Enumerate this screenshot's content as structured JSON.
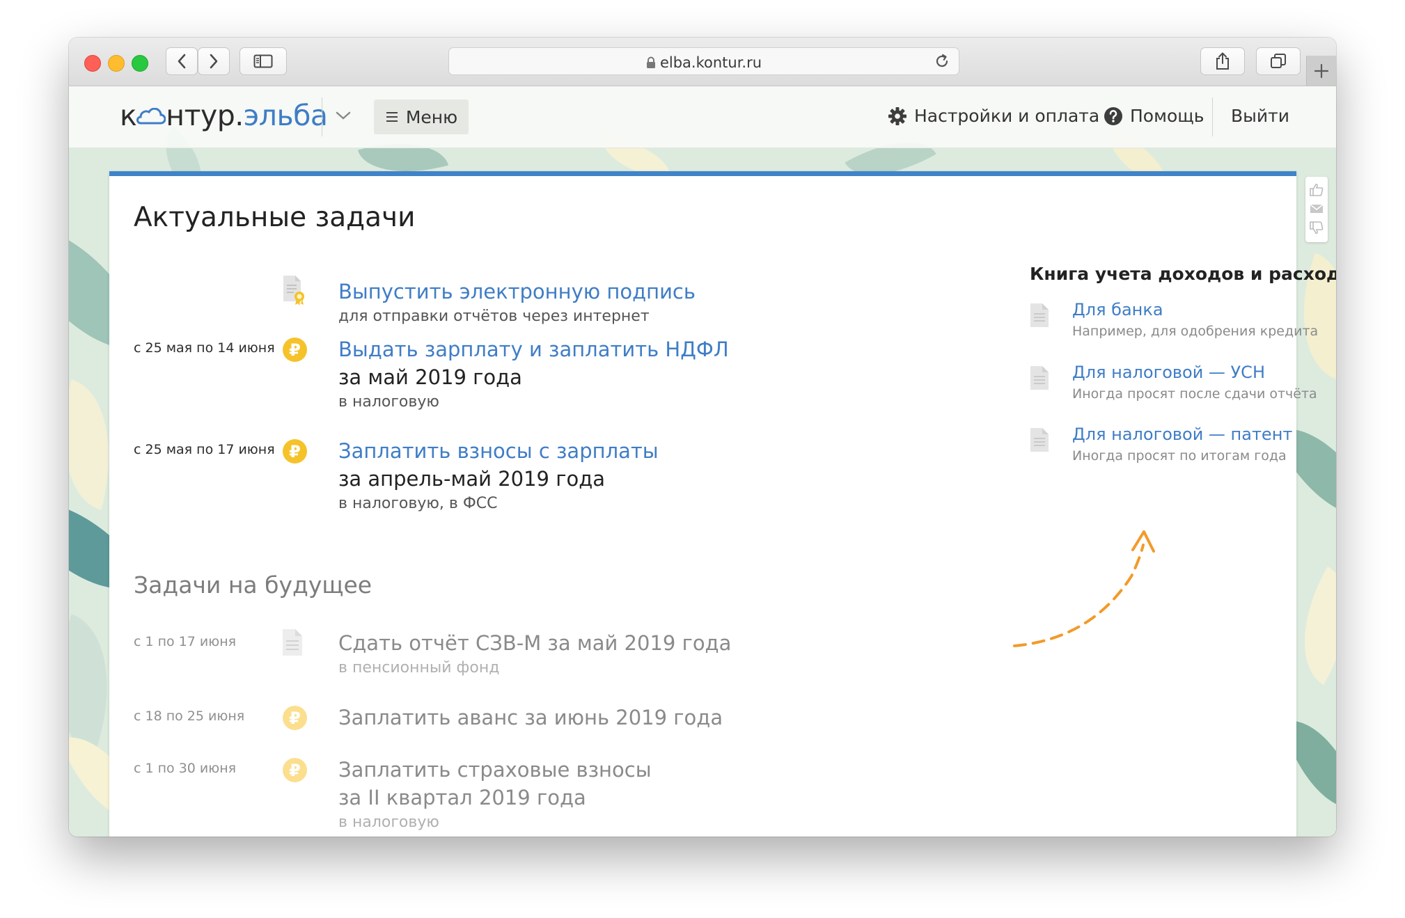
{
  "browser": {
    "url": "elba.kontur.ru",
    "icons": [
      "back-icon",
      "forward-icon",
      "sidebar-icon",
      "lock-icon",
      "reload-icon",
      "share-icon",
      "tabs-icon",
      "plus-icon"
    ]
  },
  "header": {
    "logo_part1": "к",
    "logo_part2": "нтур.",
    "logo_part3": "эльба",
    "menu_label": "Меню",
    "settings_label": "Настройки и оплата",
    "help_label": "Помощь",
    "logout_label": "Выйти",
    "brand_blue": "#3f7dc6"
  },
  "current": {
    "heading": "Актуальные задачи",
    "tasks": [
      {
        "date": "",
        "icon": "certificate-icon",
        "title": "Выпустить электронную подпись",
        "period": "",
        "subtitle": "для отправки отчётов через интернет"
      },
      {
        "date": "с 25 мая по 14 июня",
        "icon": "ruble-coin-icon",
        "title": "Выдать зарплату и заплатить НДФЛ",
        "period": "за май 2019 года",
        "subtitle": "в налоговую"
      },
      {
        "date": "с 25 мая по 17 июня",
        "icon": "ruble-coin-icon",
        "title": "Заплатить взносы с зарплаты",
        "period": "за апрель-май 2019 года",
        "subtitle": "в налоговую, в ФСС"
      }
    ]
  },
  "future": {
    "heading": "Задачи на будущее",
    "tasks": [
      {
        "date": "с 1 по 17 июня",
        "icon": "document-icon",
        "title": "Сдать отчёт СЗВ-М за май 2019 года",
        "period": "",
        "subtitle": "в пенсионный фонд"
      },
      {
        "date": "с 18 по 25 июня",
        "icon": "ruble-coin-icon",
        "title": "Заплатить аванс за июнь 2019 года",
        "period": "",
        "subtitle": ""
      },
      {
        "date": "с 1 по 30 июня",
        "icon": "ruble-coin-icon",
        "title": "Заплатить страховые взносы",
        "period": "за II квартал 2019 года",
        "subtitle": "в налоговую"
      }
    ]
  },
  "coin_symbol": "₽",
  "ledger": {
    "title": "Книга учета доходов и расходов",
    "items": [
      {
        "link": "Для банка",
        "desc": "Например, для одобрения кредита"
      },
      {
        "link": "Для налоговой — УСН",
        "desc": "Иногда просят после сдачи отчёта"
      },
      {
        "link": "Для налоговой — патент",
        "desc": "Иногда просят по итогам года"
      }
    ]
  },
  "colors": {
    "accent_blue": "#3f84c9",
    "coin_yellow": "#f6c22a",
    "arrow_orange": "#f39a2a"
  }
}
